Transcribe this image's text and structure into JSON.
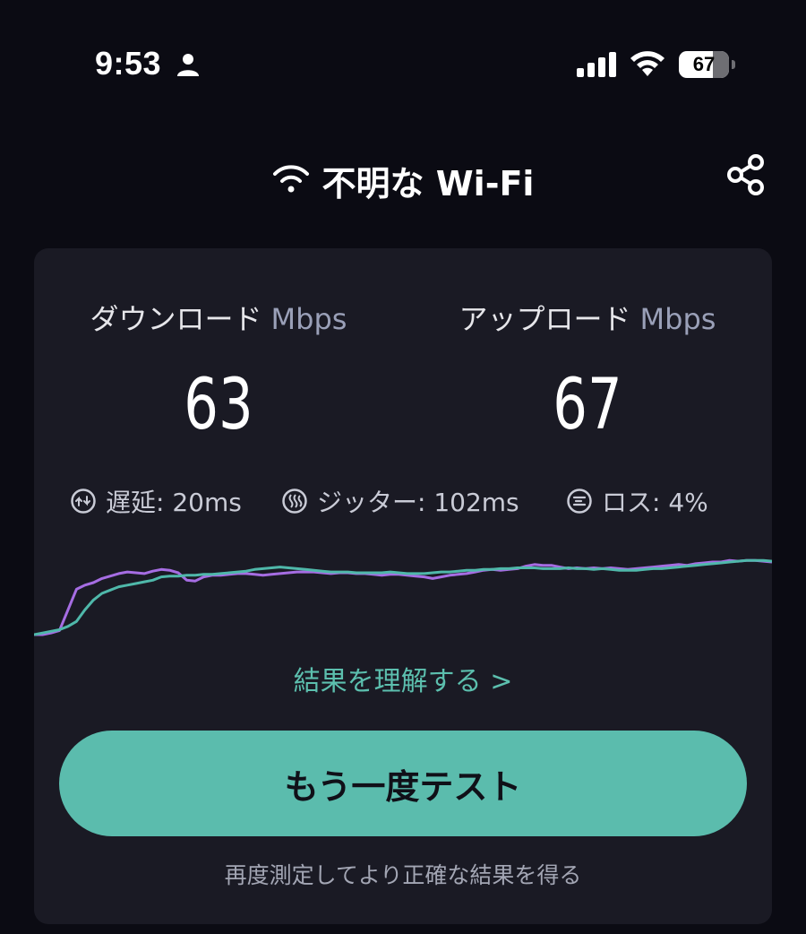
{
  "status_bar": {
    "time": "9:53",
    "battery": "67",
    "icons": [
      "person-icon",
      "signal-icon",
      "wifi-icon",
      "battery-icon"
    ]
  },
  "header": {
    "title": "不明な Wi-Fi",
    "icons": [
      "wifi-icon",
      "share-icon"
    ]
  },
  "results": {
    "download": {
      "label": "ダウンロード",
      "unit": "Mbps",
      "value": "63"
    },
    "upload": {
      "label": "アップロード",
      "unit": "Mbps",
      "value": "67"
    },
    "latency": {
      "label": "遅延: 20ms",
      "icon": "latency-icon"
    },
    "jitter": {
      "label": "ジッター: 102ms",
      "icon": "jitter-icon"
    },
    "loss": {
      "label": "ロス: 4%",
      "icon": "loss-icon"
    }
  },
  "chart_data": {
    "type": "line",
    "series": [
      {
        "color": "#a66de3",
        "values": [
          0,
          0,
          0.02,
          0.05,
          0.3,
          0.55,
          0.6,
          0.63,
          0.68,
          0.71,
          0.74,
          0.76,
          0.75,
          0.74,
          0.77,
          0.79,
          0.78,
          0.75,
          0.66,
          0.65,
          0.7,
          0.72,
          0.72,
          0.73,
          0.74,
          0.74,
          0.73,
          0.72,
          0.73,
          0.74,
          0.75,
          0.76,
          0.76,
          0.76,
          0.75,
          0.74,
          0.75,
          0.75,
          0.74,
          0.74,
          0.73,
          0.72,
          0.73,
          0.73,
          0.72,
          0.71,
          0.7,
          0.68,
          0.7,
          0.72,
          0.73,
          0.74,
          0.76,
          0.78,
          0.79,
          0.78,
          0.79,
          0.8,
          0.83,
          0.85,
          0.84,
          0.84,
          0.82,
          0.8,
          0.81,
          0.8,
          0.81,
          0.8,
          0.81,
          0.8,
          0.79,
          0.8,
          0.81,
          0.82,
          0.83,
          0.84,
          0.85,
          0.84,
          0.86,
          0.87,
          0.88,
          0.88,
          0.9,
          0.89,
          0.9,
          0.9,
          0.89,
          0.88
        ]
      },
      {
        "color": "#4fb8aa",
        "values": [
          0,
          0.02,
          0.04,
          0.06,
          0.1,
          0.16,
          0.3,
          0.42,
          0.5,
          0.54,
          0.58,
          0.6,
          0.62,
          0.64,
          0.66,
          0.7,
          0.71,
          0.71,
          0.72,
          0.72,
          0.73,
          0.73,
          0.74,
          0.75,
          0.76,
          0.77,
          0.79,
          0.8,
          0.81,
          0.82,
          0.81,
          0.8,
          0.79,
          0.78,
          0.77,
          0.76,
          0.76,
          0.76,
          0.75,
          0.75,
          0.75,
          0.75,
          0.76,
          0.75,
          0.74,
          0.74,
          0.74,
          0.75,
          0.76,
          0.76,
          0.77,
          0.78,
          0.78,
          0.79,
          0.79,
          0.8,
          0.8,
          0.81,
          0.81,
          0.81,
          0.8,
          0.8,
          0.8,
          0.81,
          0.8,
          0.8,
          0.79,
          0.8,
          0.79,
          0.78,
          0.78,
          0.78,
          0.79,
          0.8,
          0.8,
          0.81,
          0.82,
          0.83,
          0.84,
          0.85,
          0.86,
          0.87,
          0.88,
          0.89,
          0.9,
          0.9,
          0.9,
          0.89
        ]
      }
    ]
  },
  "links": {
    "understand": "結果を理解する >"
  },
  "actions": {
    "retest": "もう一度テスト",
    "hint": "再度測定してより正確な結果を得る"
  },
  "colors": {
    "background": "#0b0b13",
    "card": "#1a1a24",
    "accent": "#5bbcad",
    "download_line": "#a66de3",
    "upload_line": "#4fb8aa"
  }
}
